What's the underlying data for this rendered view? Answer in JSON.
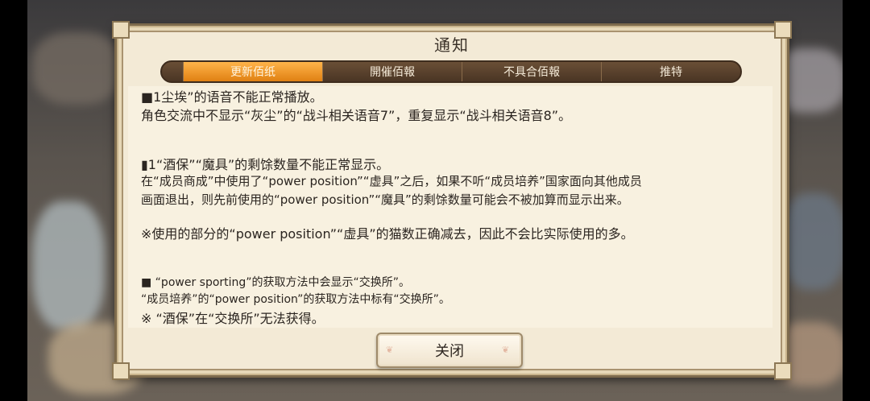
{
  "dialog": {
    "title": "通知",
    "close_label": "关闭"
  },
  "tabs": [
    {
      "label": "更新佰纸",
      "active": true
    },
    {
      "label": "開催佰報",
      "active": false
    },
    {
      "label": "不具合佰報",
      "active": false
    },
    {
      "label": "推特",
      "active": false
    }
  ],
  "content": {
    "section1_heading": "■1尘埃”的语音不能正常播放。",
    "section1_body": "角色交流中不显示“灰尘”的“战斗相关语音7”，重复显示“战斗相关语音8”。",
    "section2_heading": "▮1“酒保”“魔具”的剩馀数量不能正常显示。",
    "section2_body_1": "在“成员商成”中使用了“power position”“虚具”之后，如果不听“成员培养”国家面向其他成员",
    "section2_body_2": "画面退出，则先前使用的“power position”“魔具”的剩馀数量可能会不被加算而显示出来。",
    "section2_note": "※使用的部分的“power position”“虚具”的猫数正确减去，因此不会比实际使用的多。",
    "section3_heading": "■ “power sporting”的获取方法中会显示“交换所”。",
    "section3_body_1": "“成员培养”的“power position”的获取方法中标有“交换所”。",
    "section3_body_2": "※ “酒保”在“交换所”无法获得。"
  },
  "colors": {
    "active_tab": "#f39a2a",
    "tab_bar": "#5a4030",
    "panel": "#f3ead6"
  }
}
